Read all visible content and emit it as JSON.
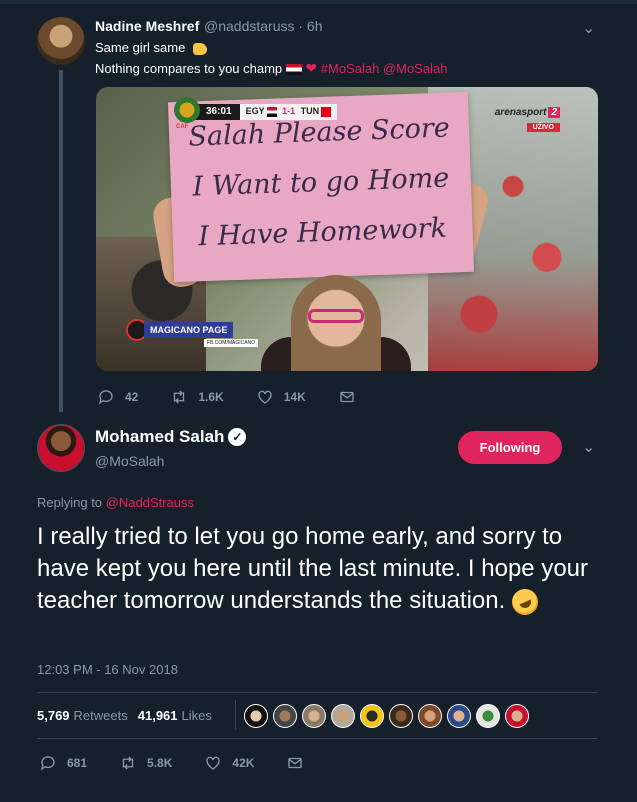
{
  "quoted_tweet": {
    "author_name": "Nadine Meshref",
    "handle_time": "@naddstaruss · 6h",
    "line1": "Same girl same",
    "line2_text": "Nothing compares to you champ",
    "line2_hashtags": "#MoSalah @MoSalah",
    "media": {
      "sign_lines": [
        "Salah Please Score",
        "I Want to go Home",
        "I Have Homework"
      ],
      "scorebug_time": "36:01",
      "scorebug_home": "EGY",
      "scorebug_score_home": "1",
      "scorebug_score_away": "1",
      "scorebug_away": "TUN",
      "caf_label": "CAF",
      "broadcaster": "arenasport",
      "broadcaster_num": "2",
      "live_label": "UŽIVO",
      "watermark": "MAGICANO PAGE",
      "watermark_sub": "FB.COM/MAGICANO"
    },
    "replies": "42",
    "retweets": "1.6K",
    "likes": "14K"
  },
  "main_tweet": {
    "author_name": "Mohamed Salah",
    "handle": "@MoSalah",
    "follow_label": "Following",
    "replying_prefix": "Replying to",
    "replying_handle": "@NaddStrauss",
    "text": "I really tried to let you go home early, and sorry to have kept you here until the last minute. I hope your teacher tomorrow understands the situation.",
    "timestamp": "12:03 PM - 16 Nov 2018",
    "retweets_count": "5,769",
    "retweets_label": "Retweets",
    "likes_count": "41,961",
    "likes_label": "Likes",
    "replies": "681",
    "retweet_action": "5.8K",
    "like_action": "42K"
  },
  "colors": {
    "background": "#15202b",
    "accent": "#e0245e",
    "muted": "#8899a6",
    "divider": "#38444d"
  },
  "icons": [
    "chevron-down-icon",
    "reply-icon",
    "retweet-icon",
    "like-icon",
    "dm-icon",
    "verified-icon",
    "clap-emoji",
    "egypt-flag-emoji",
    "heart-emoji",
    "laughing-emoji"
  ]
}
